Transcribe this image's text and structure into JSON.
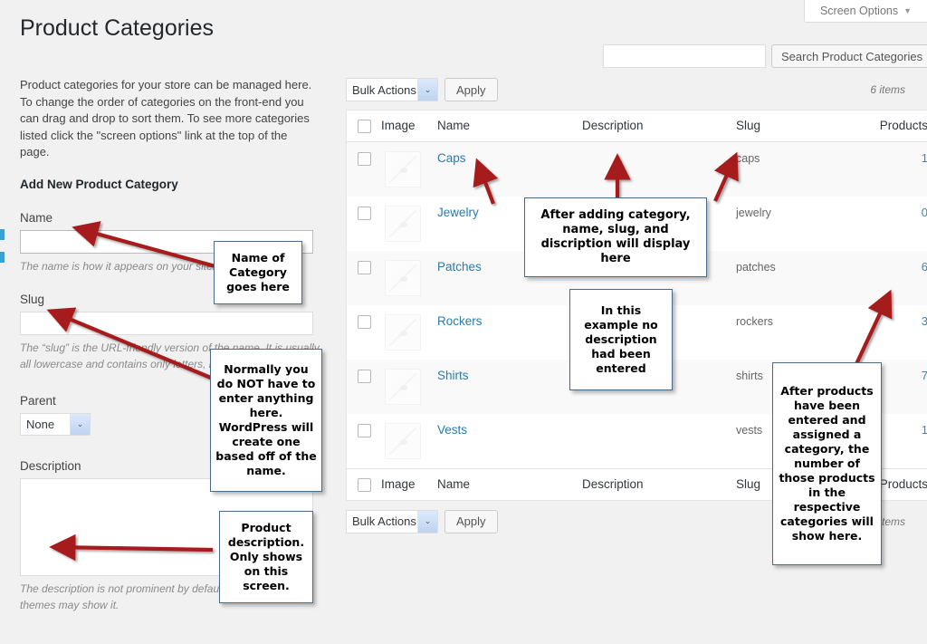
{
  "header": {
    "screen_options_label": "Screen Options",
    "screen_options_caret": "▼",
    "page_title": "Product Categories"
  },
  "search": {
    "value": "",
    "placeholder": "",
    "button_label": "Search Product Categories"
  },
  "left_panel": {
    "intro_text": "Product categories for your store can be managed here. To change the order of categories on the front-end you can drag and drop to sort them. To see more categories listed click the \"screen options\" link at the top of the page.",
    "form_heading": "Add New Product Category",
    "name": {
      "label": "Name",
      "value": "",
      "help": "The name is how it appears on your site."
    },
    "slug": {
      "label": "Slug",
      "value": "",
      "help": "The “slug” is the URL-friendly version of the name. It is usually all lowercase and contains only letters, numbers, and hyphens."
    },
    "parent": {
      "label": "Parent",
      "selected": "None",
      "caret": "⌄"
    },
    "description": {
      "label": "Description",
      "value": "",
      "help": "The description is not prominent by default; however, some themes may show it."
    }
  },
  "tablenav_top": {
    "bulk_actions_label": "Bulk Actions",
    "bulk_caret": "⌄",
    "apply_label": "Apply",
    "items_count": "6 items"
  },
  "tablenav_bottom": {
    "bulk_actions_label": "Bulk Actions",
    "bulk_caret": "⌄",
    "apply_label": "Apply",
    "items_count": "6 items"
  },
  "table": {
    "columns": [
      "Image",
      "Name",
      "Description",
      "Slug",
      "Products"
    ],
    "rows": [
      {
        "name": "Caps",
        "description": "",
        "slug": "caps",
        "products": "1"
      },
      {
        "name": "Jewelry",
        "description": "",
        "slug": "jewelry",
        "products": "0"
      },
      {
        "name": "Patches",
        "description": "",
        "slug": "patches",
        "products": "6"
      },
      {
        "name": "Rockers",
        "description": "",
        "slug": "rockers",
        "products": "3"
      },
      {
        "name": "Shirts",
        "description": "",
        "slug": "shirts",
        "products": "7"
      },
      {
        "name": "Vests",
        "description": "",
        "slug": "vests",
        "products": "1"
      }
    ]
  },
  "annotations": [
    {
      "id": "name-of-category",
      "text": "Name of Category goes here"
    },
    {
      "id": "slug-optional",
      "text": "Normally you do NOT have to enter anything here. WordPress will create one based off of the name."
    },
    {
      "id": "product-desc",
      "text": "Product description. Only shows on this screen."
    },
    {
      "id": "after-adding",
      "text": "After adding category, name, slug, and discription will display here"
    },
    {
      "id": "no-description",
      "text": "In this example no description had been entered"
    },
    {
      "id": "product-counts",
      "text": "After products have been entered and assigned a category, the number of those products in the respective categories will show here."
    }
  ],
  "colors": {
    "page_bg": "#f1f1f1",
    "accent_blue": "#3ba0d4",
    "link_blue": "#2b7ca8",
    "arrow_red": "#a61c1c",
    "callout_border": "#4a6a8a"
  }
}
